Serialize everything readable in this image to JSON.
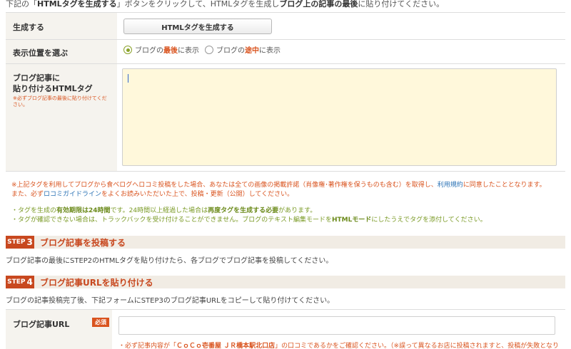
{
  "top_note": {
    "prefix": "下記の「",
    "button_ref": "HTMLタグを生成する",
    "middle": "」ボタンをクリックして、HTMLタグを生成し",
    "bold": "ブログ上の記事の最後",
    "suffix": "に貼り付けてください。"
  },
  "generate": {
    "label": "生成する",
    "button_label": "HTMLタグを生成する"
  },
  "position": {
    "label": "表示位置を選ぶ",
    "options": [
      {
        "pre": "ブログの",
        "em": "最後",
        "post": "に表示",
        "selected": true
      },
      {
        "pre": "ブログの",
        "em": "途中",
        "post": "に表示",
        "selected": false
      }
    ]
  },
  "tag_field": {
    "label_line1": "ブログ記事に",
    "label_line2": "貼り付けるHTMLタグ",
    "note": "※必ずブログ記事の最後に貼り付けてください。",
    "value": ""
  },
  "notes": {
    "line1_a": "※上記タグを利用してブログから食べログへロコミ投稿をした場合、あなたは全ての画像の掲載許諾（肖像権･著作権を保うものも含む）を取得し、",
    "line1_link": "利用規約",
    "line1_b": "に同意したこととなります。",
    "line2_a": "また、必ず",
    "line2_link": "ロコミガイドライン",
    "line2_b": "をよくお読みいただいた上で、投稿・更新（公開）してください。",
    "line3_a": "・タグを生成の",
    "line3_bold": "有効期限は24時間",
    "line3_b": "です。24時間以上経過した場合は",
    "line3_bold2": "再度タグを生成する必要",
    "line3_c": "があります。",
    "line4_a": "・タグが確認できない場合は、トラックバックを受け付けることができません。ブログのテキスト編集モードを",
    "line4_bold": "HTMLモード",
    "line4_b": "にしたうえでタグを添付してください。"
  },
  "step3": {
    "badge": "STEP",
    "num": "3",
    "title": "ブログ記事を投稿する",
    "desc": "ブログ記事の最後にSTEP2のHTMLタグを貼り付けたら、各ブログでブログ記事を投稿してください。"
  },
  "step4": {
    "badge": "STEP",
    "num": "4",
    "title": "ブログ記事URLを貼り付ける",
    "desc": "ブログの記事投稿完了後、下記フォームにSTEP3のブログ記事URLをコピーして貼り付けてください。"
  },
  "url_field": {
    "label": "ブログ記事URL",
    "required": "必須",
    "value": "",
    "note_a": "・必ず記事内容が「",
    "note_shop": "ＣｏＣｏ壱番屋 ＪＲ橋本駅北口店",
    "note_b": "」の口コミであるかをご確認ください。（※誤って異なるお店に投稿されますと、投稿が失敗となり"
  },
  "colors": {
    "accent": "#c8481f",
    "highlight": "#d9531e",
    "textarea_bg": "#fff8db",
    "green": "#7a9a25",
    "link": "#2a72b5"
  }
}
